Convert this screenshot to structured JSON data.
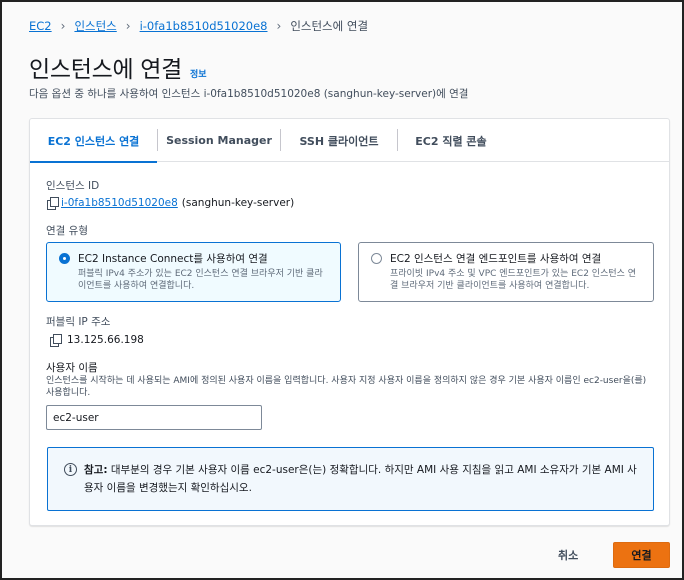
{
  "breadcrumb": {
    "items": [
      "EC2",
      "인스턴스",
      "i-0fa1b8510d51020e8"
    ],
    "current": "인스턴스에 연결"
  },
  "header": {
    "title": "인스턴스에 연결",
    "info": "정보",
    "description": "다음 옵션 중 하나를 사용하여 인스턴스 i-0fa1b8510d51020e8 (sanghun-key-server)에 연결"
  },
  "tabs": [
    {
      "label": "EC2 인스턴스 연결",
      "active": true
    },
    {
      "label": "Session Manager",
      "active": false
    },
    {
      "label": "SSH 클라이언트",
      "active": false
    },
    {
      "label": "EC2 직렬 콘솔",
      "active": false
    }
  ],
  "instance": {
    "label": "인스턴스 ID",
    "id": "i-0fa1b8510d51020e8",
    "name": "(sanghun-key-server)"
  },
  "connection_type": {
    "label": "연결 유형",
    "options": [
      {
        "title": "EC2 Instance Connect를 사용하여 연결",
        "desc": "퍼블릭 IPv4 주소가 있는 EC2 인스턴스 연결 브라우저 기반 클라이언트를 사용하여 연결합니다.",
        "selected": true
      },
      {
        "title": "EC2 인스턴스 연결 엔드포인트를 사용하여 연결",
        "desc": "프라이빗 IPv4 주소 및 VPC 엔드포인트가 있는 EC2 인스턴스 연결 브라우저 기반 클라이언트를 사용하여 연결합니다.",
        "selected": false
      }
    ]
  },
  "public_ip": {
    "label": "퍼블릭 IP 주소",
    "value": "13.125.66.198"
  },
  "username": {
    "label": "사용자 이름",
    "desc": "인스턴스를 시작하는 데 사용되는 AMI에 정의된 사용자 이름을 입력합니다. 사용자 지정 사용자 이름을 정의하지 않은 경우 기본 사용자 이름인 ec2-user을(를) 사용합니다.",
    "value": "ec2-user"
  },
  "alert": {
    "prefix": "참고:",
    "text": "대부분의 경우 기본 사용자 이름 ec2-user은(는) 정확합니다. 하지만 AMI 사용 지침을 읽고 AMI 소유자가 기본 AMI 사용자 이름을 변경했는지 확인하십시오."
  },
  "actions": {
    "cancel": "취소",
    "connect": "연결"
  },
  "colors": {
    "link": "#0972d3",
    "primary_button": "#ec7211",
    "alert_bg": "#f2f8fd"
  }
}
